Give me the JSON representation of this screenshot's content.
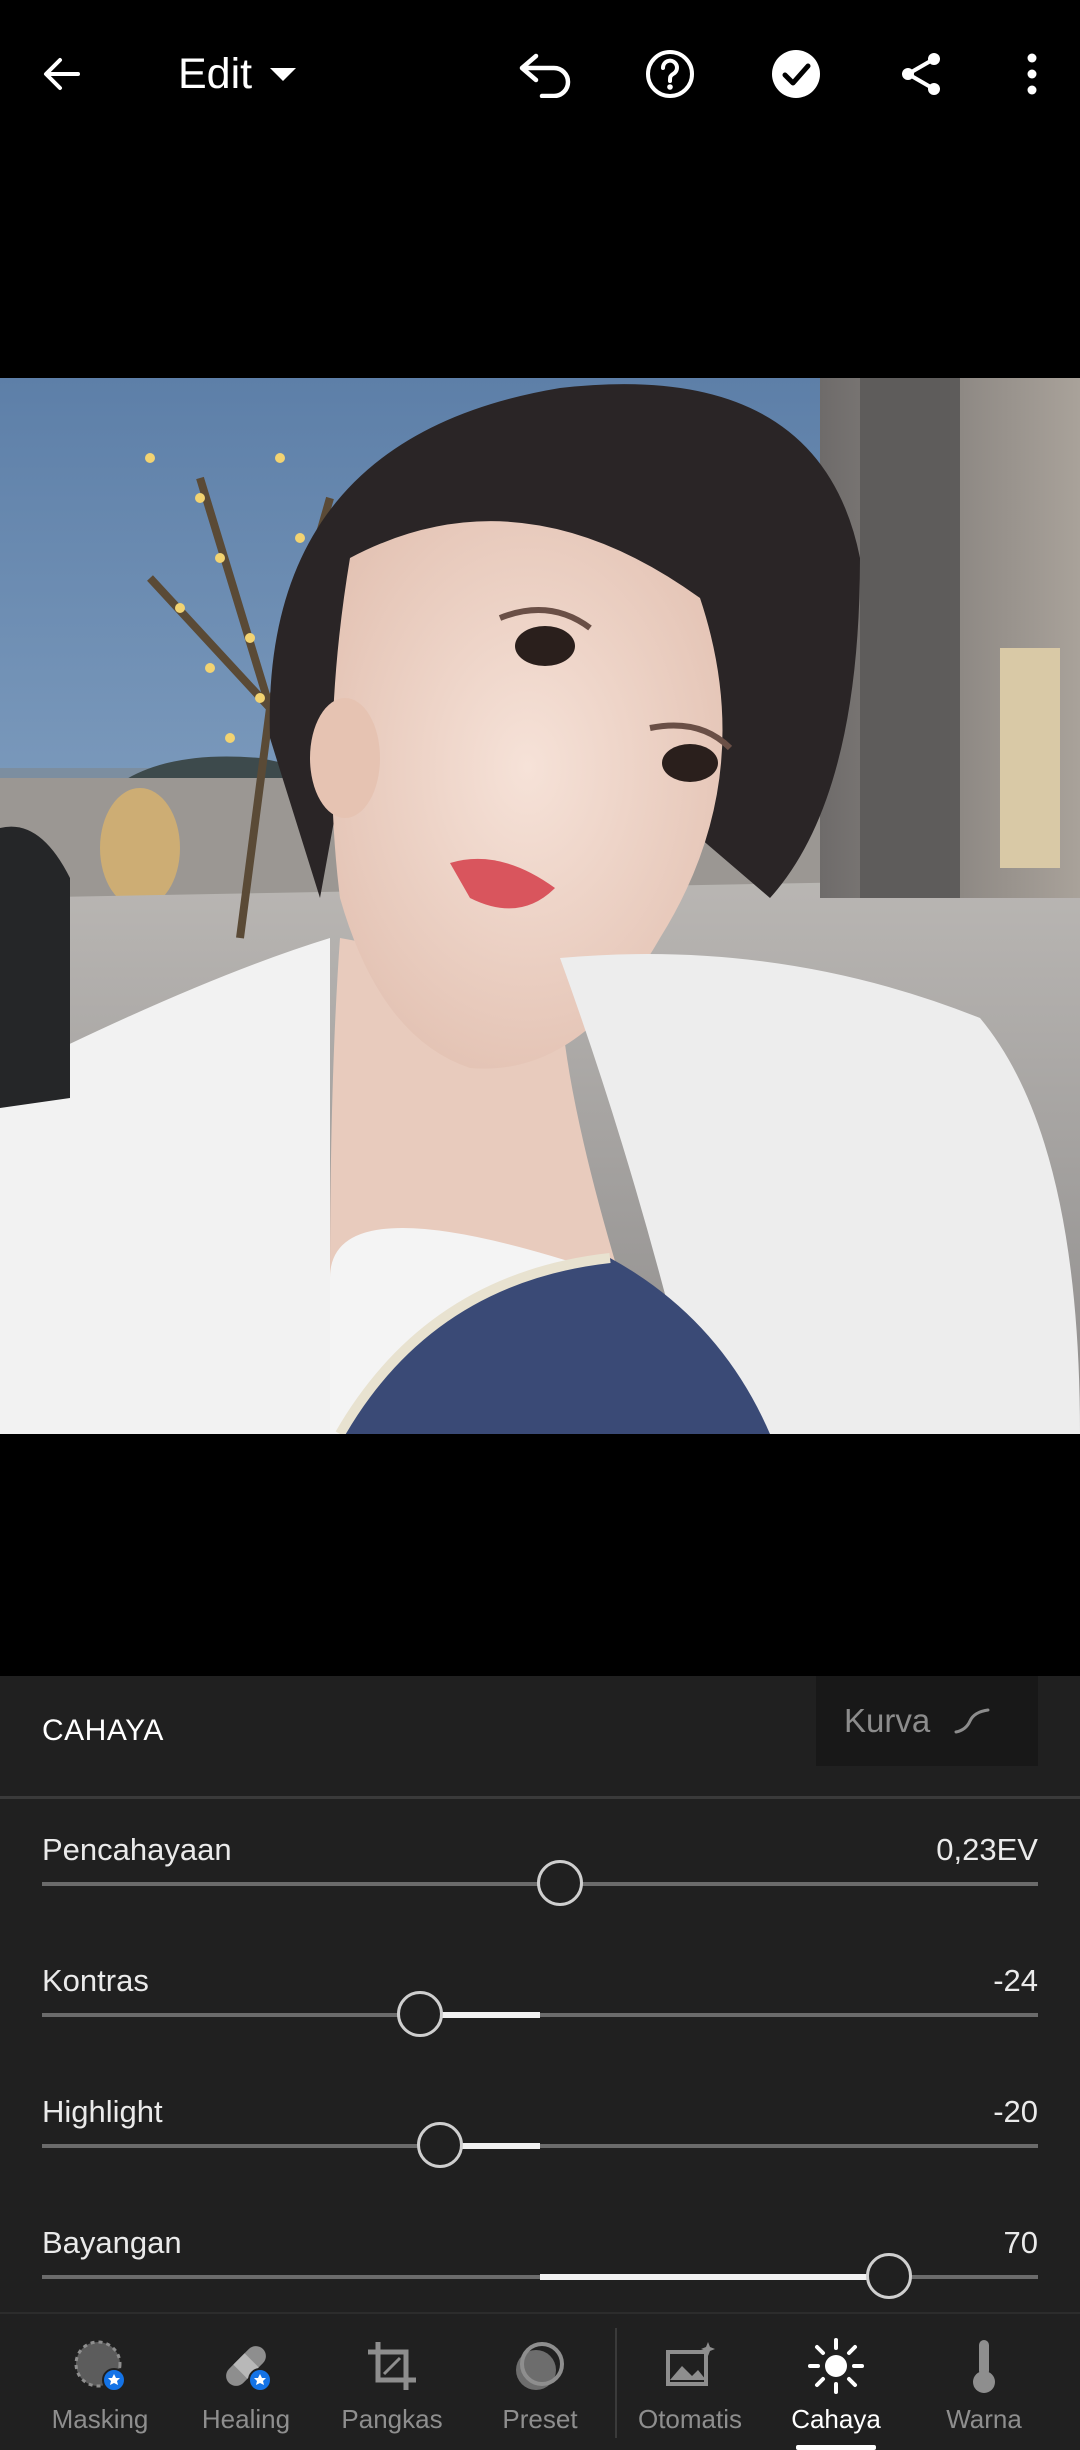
{
  "header": {
    "title": "Edit",
    "icons": [
      "back-arrow-icon",
      "caret-down-icon",
      "undo-icon",
      "help-icon",
      "done-check-icon",
      "share-icon",
      "more-vert-icon"
    ]
  },
  "photo": {
    "description_icon": "portrait-photo"
  },
  "panel": {
    "title": "CAHAYA",
    "curve_label": "Kurva",
    "sliders": [
      {
        "label": "Pencahayaan",
        "value": "0,23EV",
        "level": 0.52,
        "fill_from": 0.52,
        "fill_to": 0.52
      },
      {
        "label": "Kontras",
        "value": "-24",
        "level": 0.38,
        "fill_from": 0.38,
        "fill_to": 0.5
      },
      {
        "label": "Highlight",
        "value": "-20",
        "level": 0.4,
        "fill_from": 0.4,
        "fill_to": 0.5
      },
      {
        "label": "Bayangan",
        "value": "70",
        "level": 0.85,
        "fill_from": 0.5,
        "fill_to": 0.85
      }
    ]
  },
  "toolbar": {
    "items": [
      {
        "label": "Masking",
        "icon": "masking-icon"
      },
      {
        "label": "Healing",
        "icon": "healing-bandage-icon"
      },
      {
        "label": "Pangkas",
        "icon": "crop-icon"
      },
      {
        "label": "Preset",
        "icon": "preset-icon"
      },
      {
        "label": "Otomatis",
        "icon": "auto-image-icon"
      },
      {
        "label": "Cahaya",
        "icon": "sun-icon",
        "active": true
      },
      {
        "label": "Warna",
        "icon": "thermometer-icon"
      }
    ]
  },
  "colors": {
    "accent_blue": "#1473e6",
    "panel_bg": "#202020",
    "background": "#000000"
  }
}
